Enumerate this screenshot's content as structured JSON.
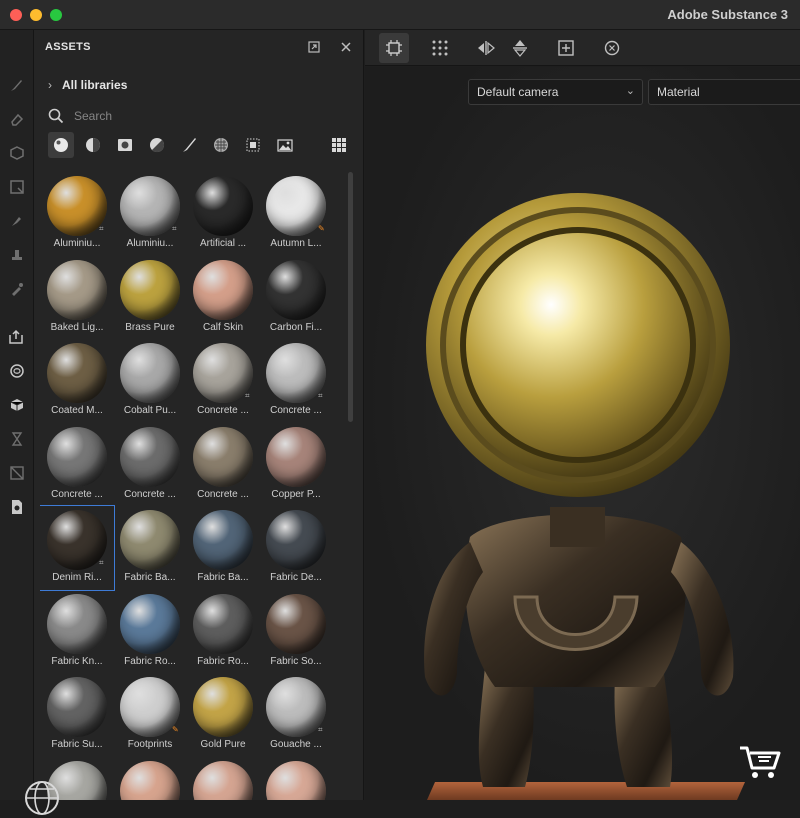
{
  "window": {
    "title": "Adobe Substance 3"
  },
  "assets_panel": {
    "title": "ASSETS",
    "library": "All libraries",
    "search_placeholder": "Search",
    "materials": [
      {
        "name": "Aluminiu...",
        "color": "#c9902a",
        "badge": "link"
      },
      {
        "name": "Aluminiu...",
        "color": "#b5b5b5",
        "badge": "link"
      },
      {
        "name": "Artificial ...",
        "color": "#2a2a2a",
        "badge": ""
      },
      {
        "name": "Autumn L...",
        "color": "#e8e8e8",
        "badge": "orange"
      },
      {
        "name": "Baked Lig...",
        "color": "#a59a88",
        "badge": ""
      },
      {
        "name": "Brass Pure",
        "color": "#bca23f",
        "badge": ""
      },
      {
        "name": "Calf Skin",
        "color": "#d49f8a",
        "badge": ""
      },
      {
        "name": "Carbon Fi...",
        "color": "#333333",
        "badge": ""
      },
      {
        "name": "Coated M...",
        "color": "#6e5f45",
        "badge": ""
      },
      {
        "name": "Cobalt Pu...",
        "color": "#a9a9a9",
        "badge": ""
      },
      {
        "name": "Concrete ...",
        "color": "#a8a49c",
        "badge": "link"
      },
      {
        "name": "Concrete ...",
        "color": "#bdbdbd",
        "badge": "link"
      },
      {
        "name": "Concrete ...",
        "color": "#777777",
        "badge": ""
      },
      {
        "name": "Concrete ...",
        "color": "#6c6c6c",
        "badge": ""
      },
      {
        "name": "Concrete ...",
        "color": "#8a7e6c",
        "badge": ""
      },
      {
        "name": "Copper P...",
        "color": "#a7847a",
        "badge": ""
      },
      {
        "name": "Denim Ri...",
        "color": "#3a332c",
        "badge": "link"
      },
      {
        "name": "Fabric Ba...",
        "color": "#8f8a70",
        "badge": ""
      },
      {
        "name": "Fabric Ba...",
        "color": "#526578",
        "badge": ""
      },
      {
        "name": "Fabric De...",
        "color": "#454b52",
        "badge": ""
      },
      {
        "name": "Fabric Kn...",
        "color": "#8a8a8a",
        "badge": ""
      },
      {
        "name": "Fabric Ro...",
        "color": "#5b7a9a",
        "badge": ""
      },
      {
        "name": "Fabric Ro...",
        "color": "#5e5e5e",
        "badge": ""
      },
      {
        "name": "Fabric So...",
        "color": "#6a5447",
        "badge": ""
      },
      {
        "name": "Fabric Su...",
        "color": "#636363",
        "badge": ""
      },
      {
        "name": "Footprints",
        "color": "#cfcfcf",
        "badge": "orange"
      },
      {
        "name": "Gold Pure",
        "color": "#c3a447",
        "badge": ""
      },
      {
        "name": "Gouache ...",
        "color": "#bdbdbd",
        "badge": "link"
      },
      {
        "name": "",
        "color": "#a7a7a2",
        "badge": ""
      },
      {
        "name": "",
        "color": "#d7a48e",
        "badge": ""
      },
      {
        "name": "",
        "color": "#d5a592",
        "badge": ""
      },
      {
        "name": "",
        "color": "#d7a896",
        "badge": ""
      }
    ],
    "selected_index": 16
  },
  "viewport": {
    "camera": "Default camera",
    "mode": "Material"
  }
}
